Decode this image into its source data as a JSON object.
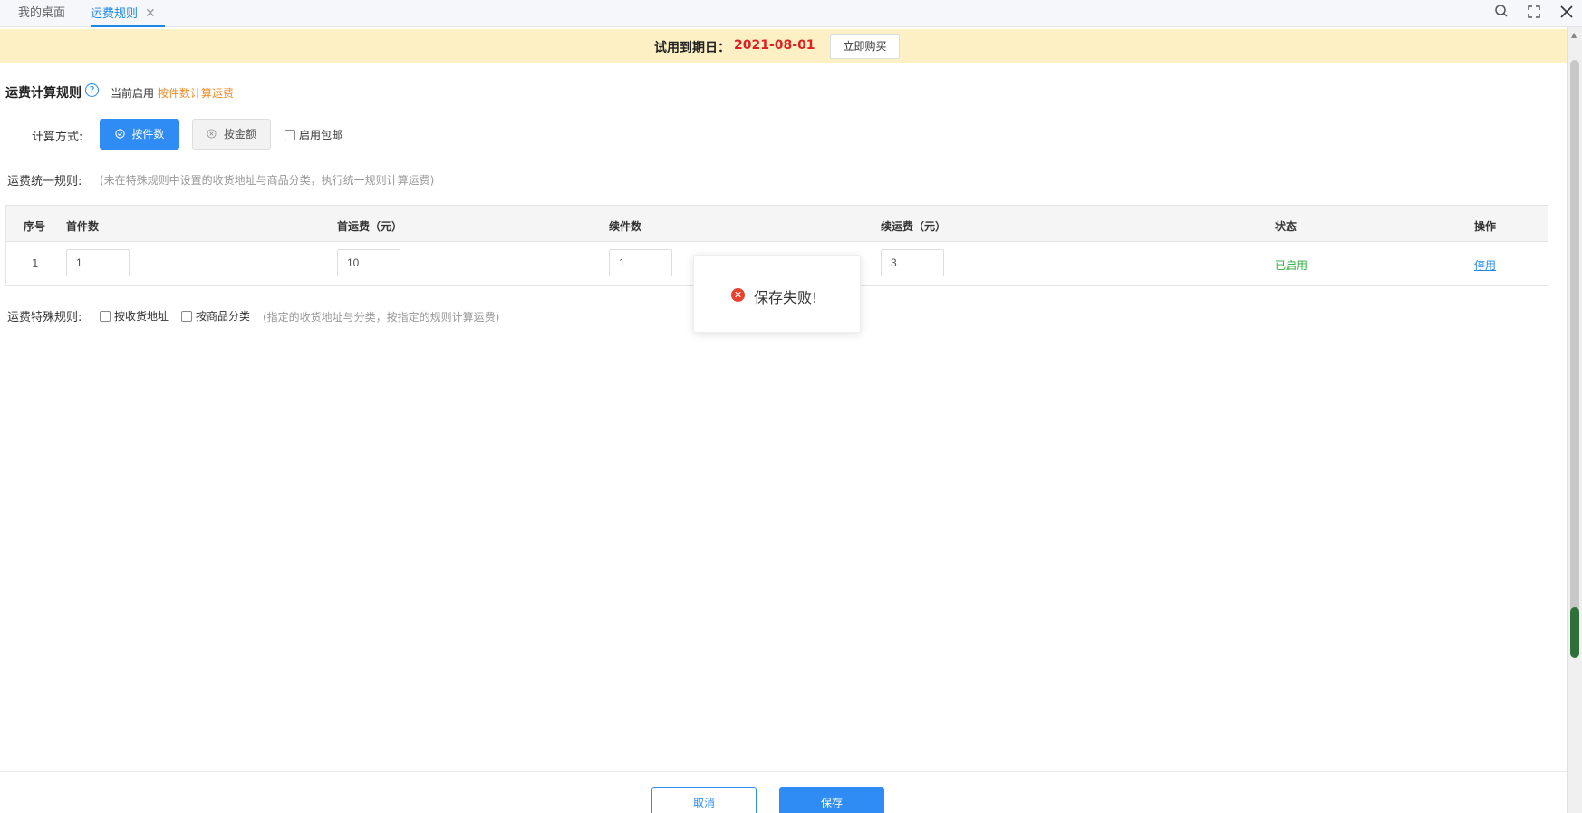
{
  "tabs": {
    "home": "我的桌面",
    "active": "运费规则",
    "close_glyph": "✕"
  },
  "toolbar_icons": [
    "search-icon",
    "fullscreen-icon",
    "close-icon"
  ],
  "banner": {
    "label": "试用到期日：",
    "date": "2021-08-01",
    "buy_button": "立即购买"
  },
  "rule": {
    "title": "运费计算规则",
    "help_glyph": "?",
    "current_label": "当前启用",
    "current_value": "按件数计算运费",
    "calc_label": "计算方式:",
    "by_piece": "按件数",
    "by_amount": "按金额",
    "free_shipping": "启用包邮"
  },
  "unified": {
    "label": "运费统一规则:",
    "hint": "(未在特殊规则中设置的收货地址与商品分类，执行统一规则计算运费)"
  },
  "table": {
    "headers": [
      "序号",
      "首件数",
      "首运费（元）",
      "续件数",
      "续运费（元）",
      "状态",
      "操作"
    ],
    "rows": [
      {
        "index": "1",
        "first_count": "1",
        "first_fee": "10",
        "extra_count": "1",
        "extra_fee": "3",
        "status": "已启用",
        "action": "停用"
      }
    ]
  },
  "special": {
    "label": "运费特殊规则:",
    "by_address": "按收货地址",
    "by_category": "按商品分类",
    "hint": "(指定的收货地址与分类，按指定的规则计算运费)"
  },
  "toast": {
    "message": "保存失败!"
  },
  "footer": {
    "cancel": "取消",
    "save": "保存"
  },
  "colors": {
    "primary": "#2f8cf5",
    "banner_bg": "#fdf0c4",
    "date_red": "#e02020",
    "status_green": "#2eaa3b",
    "accent_orange": "#f08a24",
    "error_red": "#e9412e"
  }
}
